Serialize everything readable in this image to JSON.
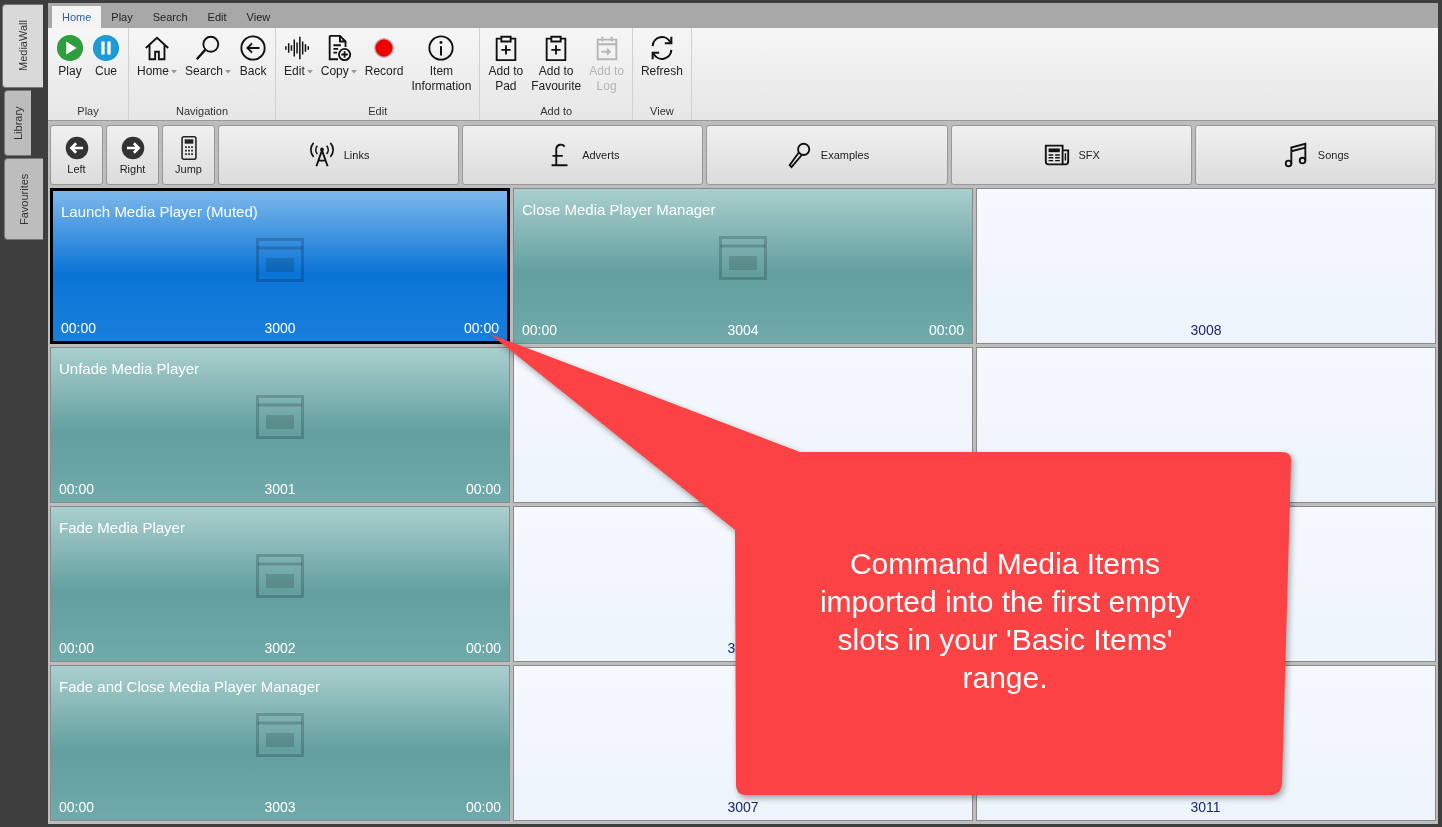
{
  "sidebar_tabs": [
    {
      "label": "MediaWall",
      "selected": true
    },
    {
      "label": "Library",
      "selected": false
    },
    {
      "label": "Favourites",
      "selected": false
    }
  ],
  "ribbon": {
    "tabs": [
      {
        "label": "Home",
        "selected": true
      },
      {
        "label": "Play",
        "selected": false
      },
      {
        "label": "Search",
        "selected": false
      },
      {
        "label": "Edit",
        "selected": false
      },
      {
        "label": "View",
        "selected": false
      }
    ],
    "groups": [
      {
        "label": "Play",
        "buttons": [
          {
            "kind": "play",
            "lines": [
              "Play"
            ],
            "dropdown": false,
            "disabled": false
          },
          {
            "kind": "pause",
            "lines": [
              "Cue"
            ],
            "dropdown": false,
            "disabled": false
          }
        ]
      },
      {
        "label": "Navigation",
        "buttons": [
          {
            "kind": "home",
            "lines": [
              "Home"
            ],
            "dropdown": true,
            "disabled": false
          },
          {
            "kind": "search",
            "lines": [
              "Search"
            ],
            "dropdown": true,
            "disabled": false
          },
          {
            "kind": "back",
            "lines": [
              "Back"
            ],
            "dropdown": false,
            "disabled": false
          }
        ]
      },
      {
        "label": "Edit",
        "buttons": [
          {
            "kind": "waveform",
            "lines": [
              "Edit"
            ],
            "dropdown": true,
            "disabled": false
          },
          {
            "kind": "copy",
            "lines": [
              "Copy"
            ],
            "dropdown": true,
            "disabled": false
          },
          {
            "kind": "record",
            "lines": [
              "Record"
            ],
            "dropdown": false,
            "disabled": false
          },
          {
            "kind": "info",
            "lines": [
              "Item",
              "Information"
            ],
            "dropdown": false,
            "disabled": false
          }
        ]
      },
      {
        "label": "Add to",
        "buttons": [
          {
            "kind": "clipboard",
            "lines": [
              "Add to",
              "Pad"
            ],
            "dropdown": false,
            "disabled": false
          },
          {
            "kind": "clipboard",
            "lines": [
              "Add to",
              "Favourite"
            ],
            "dropdown": false,
            "disabled": false
          },
          {
            "kind": "log",
            "lines": [
              "Add to",
              "Log"
            ],
            "dropdown": false,
            "disabled": true
          }
        ]
      },
      {
        "label": "View",
        "buttons": [
          {
            "kind": "refresh",
            "lines": [
              "Refresh"
            ],
            "dropdown": false,
            "disabled": false
          }
        ]
      }
    ]
  },
  "nav_buttons": [
    {
      "kind": "left",
      "label": "Left"
    },
    {
      "kind": "right",
      "label": "Right"
    },
    {
      "kind": "calculator",
      "label": "Jump"
    }
  ],
  "categories": [
    {
      "kind": "antenna",
      "label": "Links"
    },
    {
      "kind": "pound",
      "label": "Adverts"
    },
    {
      "kind": "microphone",
      "label": "Examples"
    },
    {
      "kind": "newspaper",
      "label": "SFX"
    },
    {
      "kind": "music",
      "label": "Songs"
    }
  ],
  "pads": [
    {
      "kind": "command",
      "title": "Launch Media Player (Muted)",
      "number": "3000",
      "start": "00:00",
      "end": "00:00",
      "selected": true
    },
    {
      "kind": "command",
      "title": "Close Media Player Manager",
      "number": "3004",
      "start": "00:00",
      "end": "00:00",
      "selected": false
    },
    {
      "kind": "empty",
      "number": "3008"
    },
    {
      "kind": "command",
      "title": "Unfade Media Player",
      "number": "3001",
      "start": "00:00",
      "end": "00:00",
      "selected": false
    },
    {
      "kind": "empty"
    },
    {
      "kind": "empty"
    },
    {
      "kind": "command",
      "title": "Fade Media Player",
      "number": "3002",
      "start": "00:00",
      "end": "00:00",
      "selected": false
    },
    {
      "kind": "empty",
      "number": "3"
    },
    {
      "kind": "empty"
    },
    {
      "kind": "command",
      "title": "Fade and Close Media Player Manager",
      "number": "3003",
      "start": "00:00",
      "end": "00:00",
      "selected": false
    },
    {
      "kind": "empty",
      "number": "3007"
    },
    {
      "kind": "empty",
      "number": "3011"
    }
  ],
  "callout": {
    "text": "Command Media Items imported into the first empty slots in your 'Basic Items' range."
  }
}
